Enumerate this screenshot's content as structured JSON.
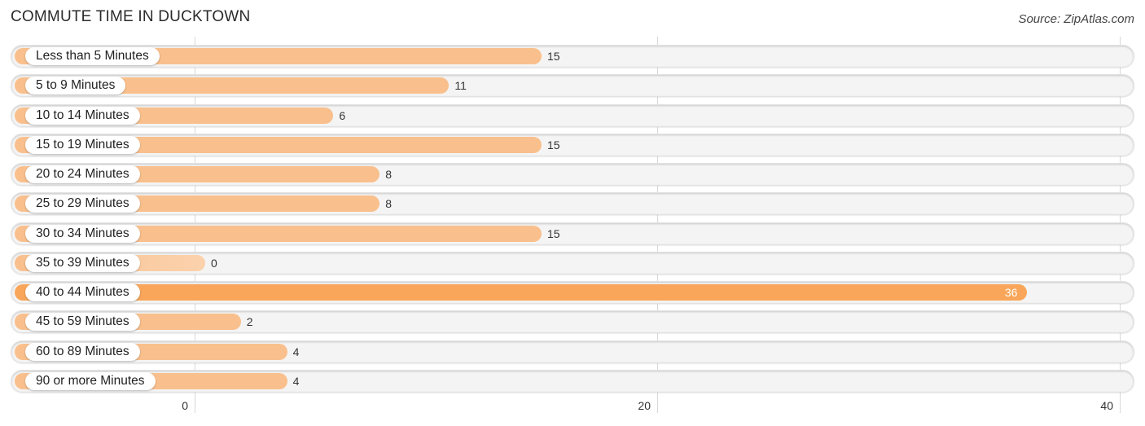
{
  "header": {
    "title": "COMMUTE TIME IN DUCKTOWN",
    "source": "Source: ZipAtlas.com"
  },
  "colors": {
    "bar_normal": "#f9c08d",
    "bar_highlight": "#f9a65a",
    "track": "#f4f4f4"
  },
  "chart_data": {
    "type": "bar",
    "orientation": "horizontal",
    "title": "COMMUTE TIME IN DUCKTOWN",
    "xlabel": "",
    "ylabel": "",
    "xlim": [
      0,
      40
    ],
    "xticks": [
      0,
      20,
      40
    ],
    "xtick_labels": [
      "0",
      "20",
      "40"
    ],
    "grid": true,
    "legend": "none",
    "highlight_index": 8,
    "categories": [
      "Less than 5 Minutes",
      "5 to 9 Minutes",
      "10 to 14 Minutes",
      "15 to 19 Minutes",
      "20 to 24 Minutes",
      "25 to 29 Minutes",
      "30 to 34 Minutes",
      "35 to 39 Minutes",
      "40 to 44 Minutes",
      "45 to 59 Minutes",
      "60 to 89 Minutes",
      "90 or more Minutes"
    ],
    "values": [
      15,
      11,
      6,
      15,
      8,
      8,
      15,
      0,
      36,
      2,
      4,
      4
    ]
  }
}
